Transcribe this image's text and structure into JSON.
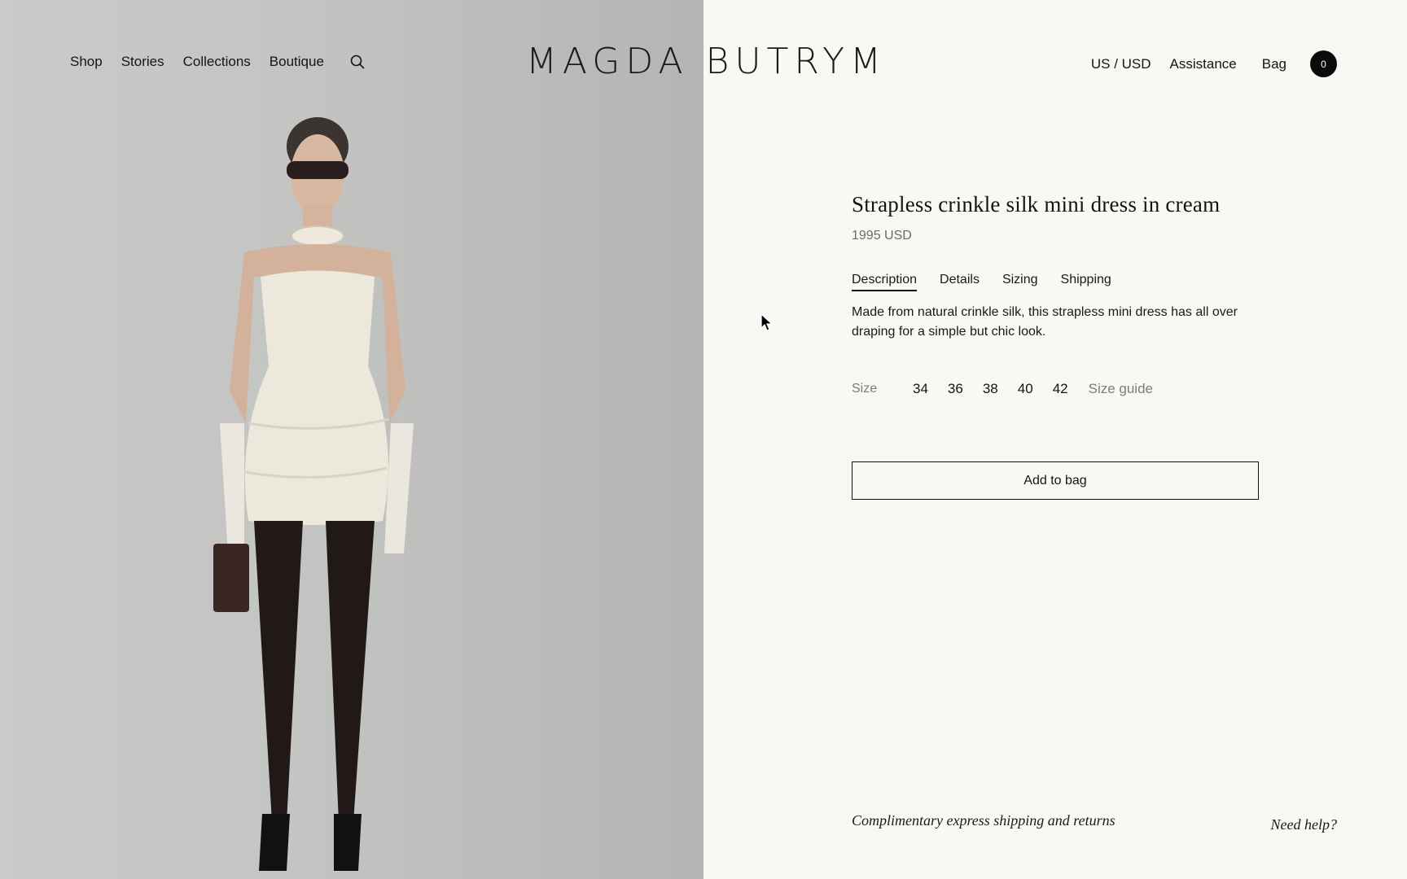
{
  "header": {
    "nav_left": [
      "Shop",
      "Stories",
      "Collections",
      "Boutique"
    ],
    "search_icon": "search-icon",
    "logo": "MAGDA BUTRYM",
    "region": "US / USD",
    "assistance": "Assistance",
    "bag": "Bag",
    "bag_count": "0"
  },
  "hero": {
    "image": "model-in-strapless-cream-dress"
  },
  "product": {
    "title": "Strapless crinkle silk mini dress in cream",
    "price": "1995 USD",
    "tabs": [
      {
        "label": "Description",
        "active": true
      },
      {
        "label": "Details",
        "active": false
      },
      {
        "label": "Sizing",
        "active": false
      },
      {
        "label": "Shipping",
        "active": false
      }
    ],
    "description": "Made from natural crinkle silk, this strapless mini dress has all over draping for a simple but chic look.",
    "size_label": "Size",
    "sizes": [
      "34",
      "36",
      "38",
      "40",
      "42"
    ],
    "size_guide": "Size guide",
    "add_to_bag": "Add to bag"
  },
  "footer": {
    "shipping_note": "Complimentary express shipping and returns",
    "need_help": "Need help?"
  },
  "colors": {
    "panel_bg": "#f9f8f5",
    "text": "#111111",
    "muted": "#7a7a7a",
    "badge_bg": "#0b0b0b"
  }
}
